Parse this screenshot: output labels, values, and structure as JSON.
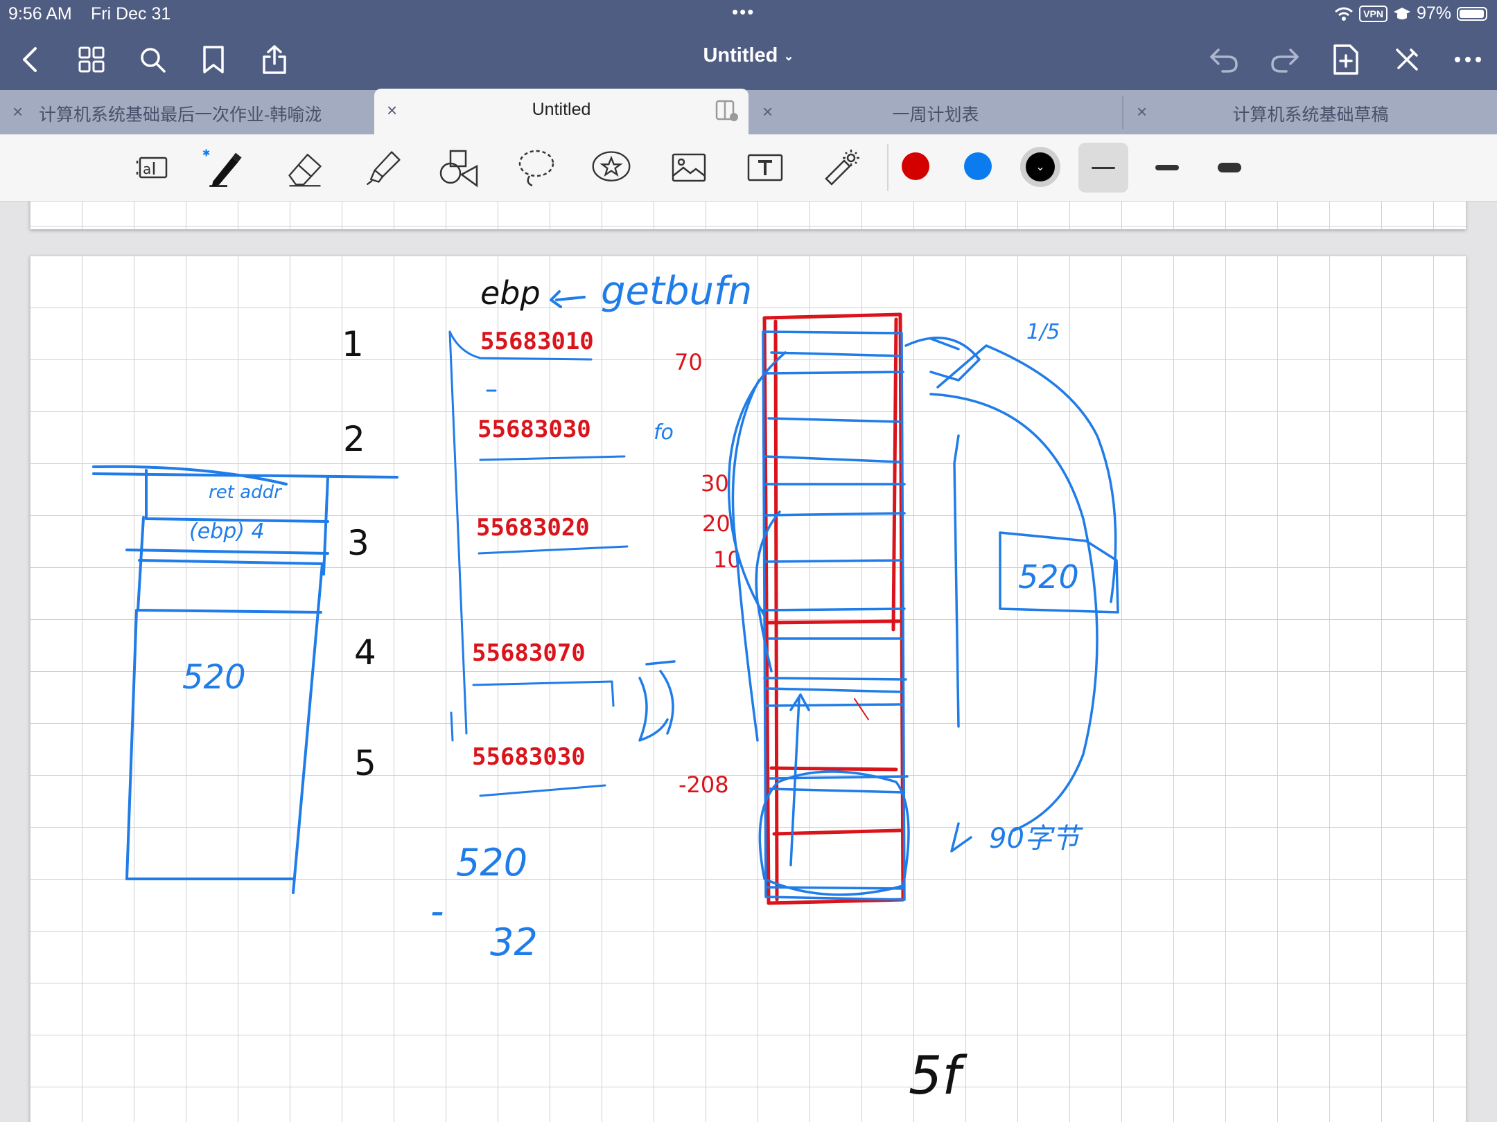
{
  "status_bar": {
    "time": "9:56 AM",
    "date": "Fri Dec 31",
    "vpn": "VPN",
    "battery": "97%",
    "battery_level": 0.97
  },
  "nav": {
    "title": "Untitled",
    "icons": [
      "back-icon",
      "grid-icon",
      "search-icon",
      "bookmark-icon",
      "share-icon",
      "undo-icon",
      "redo-icon",
      "add-page-icon",
      "pen-off-icon",
      "more-icon"
    ]
  },
  "tabs": [
    {
      "label": "计算机系统基础最后一次作业-韩喻泷",
      "active": false
    },
    {
      "label": "Untitled",
      "active": true
    },
    {
      "label": "一周计划表",
      "active": false
    },
    {
      "label": "计算机系统基础草稿",
      "active": false
    }
  ],
  "toolbar": {
    "tools": [
      "scan-text-icon",
      "pen-icon",
      "eraser-icon",
      "highlighter-icon",
      "shapes-icon",
      "lasso-icon",
      "sticker-icon",
      "image-icon",
      "text-box-icon",
      "laser-pointer-icon"
    ],
    "colors": [
      "#d40000",
      "#0a7cf0",
      "#000000"
    ],
    "selected_color": "#000000",
    "stroke_widths": [
      "thin",
      "medium",
      "thick"
    ],
    "selected_width": "thin"
  },
  "ink_colors": {
    "blue": "#1f7ce8",
    "red": "#d9141b",
    "black": "#111111"
  },
  "notes": {
    "numbers": [
      "1",
      "2",
      "3",
      "4",
      "5"
    ],
    "ebp_label": "ebp",
    "getbufn_label": "getbufn",
    "addresses": [
      "55683010",
      "55683030",
      "55683020",
      "55683070",
      "55683030"
    ],
    "offsets": [
      "70",
      "30",
      "20",
      "10",
      "-208"
    ],
    "box_left_line1": "ret addr",
    "box_left_line2": "(ebp) 4",
    "box_left_size": "520",
    "right_box_label": "520",
    "side_note_fo": "fo",
    "side_note_right": "90字节",
    "side_note_top": "1/5",
    "calc_520": "520",
    "calc_minus": "-",
    "calc_32": "32",
    "bottom_5f": "5f"
  }
}
